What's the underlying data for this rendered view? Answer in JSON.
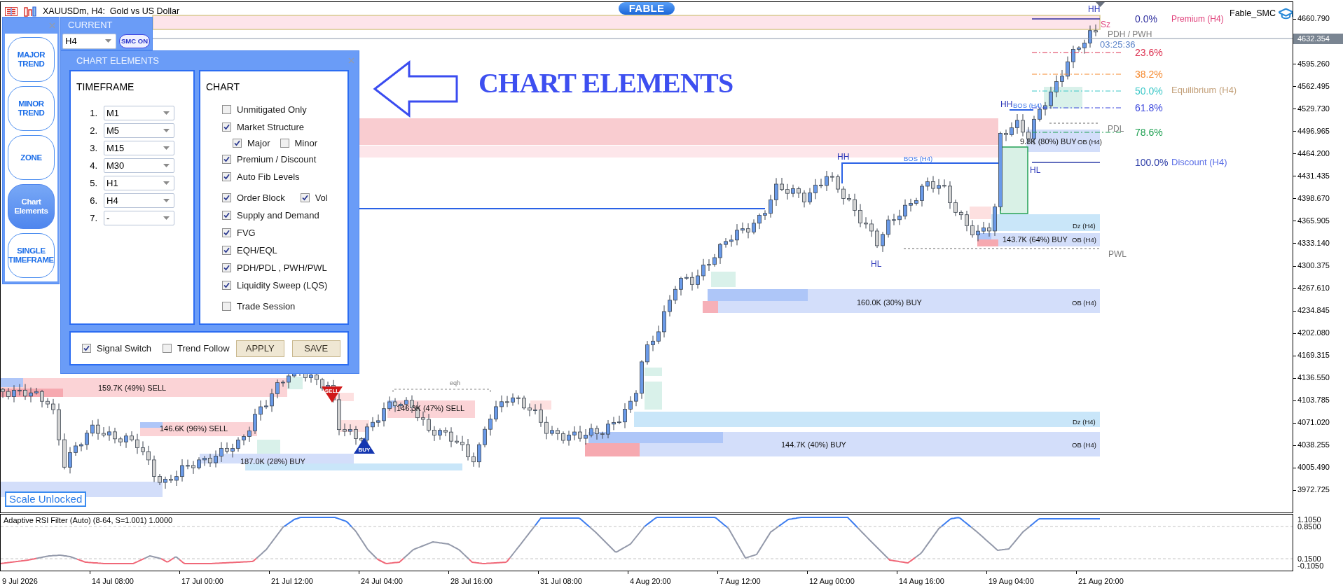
{
  "window": {
    "title": "XAUUSDm, H4:  Gold vs US Dollar",
    "badge": "FABLE",
    "indicator_label": "Fable_SMC"
  },
  "side_menu": {
    "items": [
      {
        "label": "MAJOR TREND",
        "selected": false
      },
      {
        "label": "MINOR TREND",
        "selected": false
      },
      {
        "label": "ZONE",
        "selected": false
      },
      {
        "label": "Chart Elements",
        "selected": true
      },
      {
        "label": "SINGLE TIMEFRAME",
        "selected": false
      }
    ]
  },
  "current_panel": {
    "title": "CURRENT",
    "timeframe": "H4",
    "smc_button": "SMC ON"
  },
  "elements_panel": {
    "title": "CHART ELEMENTS",
    "timeframe_box": {
      "title": "TIMEFRAME",
      "rows": [
        {
          "number": "1.",
          "value": "M1"
        },
        {
          "number": "2.",
          "value": "M5"
        },
        {
          "number": "3.",
          "value": "M15"
        },
        {
          "number": "4.",
          "value": "M30"
        },
        {
          "number": "5.",
          "value": "H1"
        },
        {
          "number": "6.",
          "value": "H4"
        },
        {
          "number": "7.",
          "value": "-"
        }
      ]
    },
    "chart_box": {
      "title": "CHART",
      "options": [
        {
          "label": "Unmitigated Only",
          "checked": false
        },
        {
          "label": "Market Structure",
          "checked": true,
          "children": [
            {
              "label": "Major",
              "checked": true
            },
            {
              "label": "Minor",
              "checked": false
            }
          ]
        },
        {
          "label": "Premium / Discount",
          "checked": true
        },
        {
          "label": "Auto Fib Levels",
          "checked": true
        },
        {
          "label": "Order Block",
          "checked": true,
          "extra": {
            "label": "Vol",
            "checked": true
          }
        },
        {
          "label": "Supply and Demand",
          "checked": true
        },
        {
          "label": "FVG",
          "checked": true
        },
        {
          "label": "EQH/EQL",
          "checked": true
        },
        {
          "label": "PDH/PDL , PWH/PWL",
          "checked": true
        },
        {
          "label": "Liquidity Sweep (LQS)",
          "checked": true
        },
        {
          "label": "Trade Session",
          "checked": false
        }
      ]
    },
    "footer": {
      "options": [
        {
          "label": "Signal Switch",
          "checked": true
        },
        {
          "label": "Trend Follow",
          "checked": false
        }
      ],
      "buttons": [
        "APPLY",
        "SAVE"
      ]
    }
  },
  "callout": {
    "text": "CHART ELEMENTS"
  },
  "chart": {
    "annotations": [
      {
        "text": "HH",
        "kind": "structure"
      },
      {
        "text": "Premium (H4)",
        "kind": "premium"
      },
      {
        "text": "Sz",
        "kind": "premium"
      },
      {
        "text": "PDH / PWH",
        "kind": "level"
      },
      {
        "text": "03:25:36",
        "kind": "timer"
      },
      {
        "text": "Equilibrium (H4)",
        "kind": "equilibrium"
      },
      {
        "text": "HH",
        "kind": "structure"
      },
      {
        "text": "BOS (H4)",
        "kind": "break"
      },
      {
        "text": "PDL",
        "kind": "level"
      },
      {
        "text": "9.8K (80%) BUY",
        "kind": "volume"
      },
      {
        "text": "OB (H4)",
        "kind": "tag"
      },
      {
        "text": "HH",
        "kind": "structure"
      },
      {
        "text": "BOS (H4)",
        "kind": "break"
      },
      {
        "text": "Discount (H4)",
        "kind": "discount"
      },
      {
        "text": "HL",
        "kind": "structure"
      },
      {
        "text": "Dz (H4)",
        "kind": "tag"
      },
      {
        "text": "143.7K (64%) BUY",
        "kind": "volume"
      },
      {
        "text": "OB (H4)",
        "kind": "tag"
      },
      {
        "text": "PWL",
        "kind": "level"
      },
      {
        "text": "HL",
        "kind": "structure"
      },
      {
        "text": "160.0K (30%) BUY",
        "kind": "volume"
      },
      {
        "text": "OB (H4)",
        "kind": "tag"
      },
      {
        "text": "eqh",
        "kind": "equal"
      },
      {
        "text": "159.7K (49%) SELL",
        "kind": "volume"
      },
      {
        "text": "146.3K (47%) SELL",
        "kind": "volume"
      },
      {
        "text": "Dz (H4)",
        "kind": "tag"
      },
      {
        "text": "146.6K (96%) SELL",
        "kind": "volume"
      },
      {
        "text": "144.7K (40%) BUY",
        "kind": "volume"
      },
      {
        "text": "OB (H4)",
        "kind": "tag"
      },
      {
        "text": "187.0K (28%) BUY",
        "kind": "volume"
      }
    ],
    "fib_levels": [
      {
        "label": "0.0%",
        "color": "#2e2e9e"
      },
      {
        "label": "23.6%",
        "color": "#dc2f4f"
      },
      {
        "label": "38.2%",
        "color": "#f5892e"
      },
      {
        "label": "50.0%",
        "color": "#3cc8c8"
      },
      {
        "label": "61.8%",
        "color": "#3b47dd"
      },
      {
        "label": "78.6%",
        "color": "#1fa052"
      },
      {
        "label": "100.0%",
        "color": "#2e3ea8"
      }
    ],
    "signals": [
      {
        "kind": "sell",
        "label": "SELL"
      },
      {
        "kind": "buy",
        "label": "BUY"
      }
    ],
    "scale_status": "Scale Unlocked",
    "price_axis": [
      "4660.790",
      "4595.260",
      "4562.495",
      "4529.730",
      "4496.965",
      "4464.200",
      "4431.435",
      "4398.670",
      "4365.905",
      "4333.140",
      "4300.375",
      "4267.610",
      "4234.845",
      "4202.080",
      "4169.315",
      "4136.550",
      "4103.785",
      "4071.020",
      "4038.255",
      "4005.490",
      "3972.725"
    ],
    "current_price": "4632.354",
    "time_axis": [
      "9 Jul 2026",
      "14 Jul 08:00",
      "17 Jul 00:00",
      "21 Jul 12:00",
      "24 Jul 04:00",
      "28 Jul 16:00",
      "31 Jul 08:00",
      "4 Aug 20:00",
      "7 Aug 12:00",
      "12 Aug 00:00",
      "14 Aug 16:00",
      "19 Aug 04:00",
      "21 Aug 20:00"
    ]
  },
  "indicator": {
    "title": "Adaptive RSI Filter (Auto) (8-64, S=1.001) 1.0000",
    "axis": [
      "1.1050",
      "0.8500",
      "0.1500",
      "-0.1050"
    ]
  }
}
